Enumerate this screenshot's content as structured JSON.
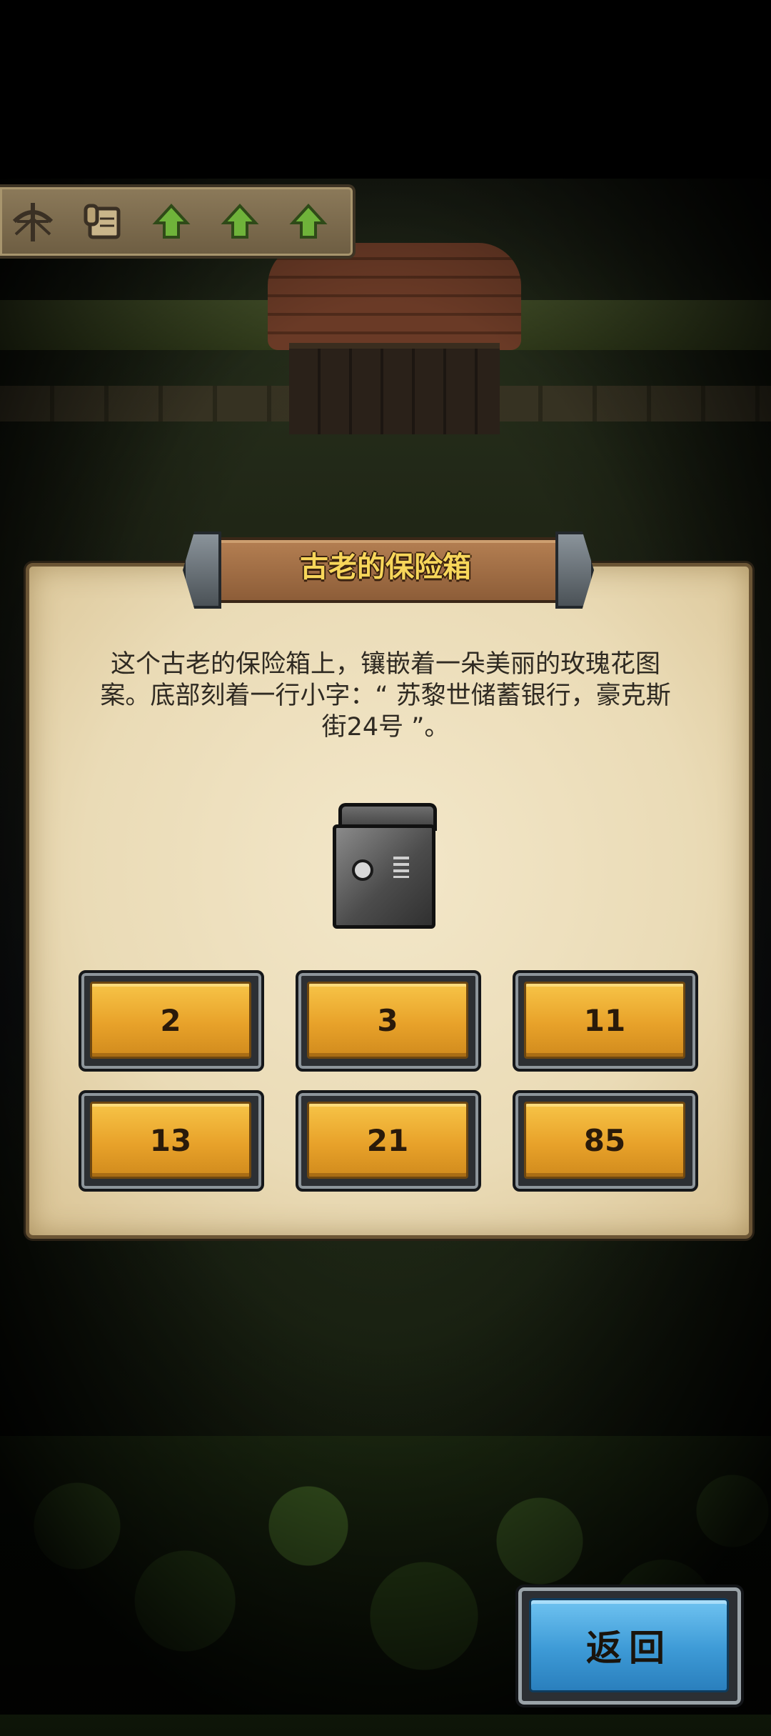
{
  "toolbar": {
    "icons": [
      "crossbow-icon",
      "map-scroll-icon",
      "green-up-arrow-icon",
      "green-up-arrow-icon",
      "green-up-arrow-icon"
    ]
  },
  "dialog": {
    "title": "古老的保险箱",
    "description": "这个古老的保险箱上，镶嵌着一朵美丽的玫瑰花图案。底部刻着一行小字：“ 苏黎世储蓄银行，豪克斯街24号 ”。",
    "item_icon": "safe-icon",
    "options": [
      "2",
      "3",
      "11",
      "13",
      "21",
      "85"
    ]
  },
  "back_button": {
    "label": "返回"
  },
  "colors": {
    "option_gold": "#e8a22a",
    "title_text": "#f7d65a",
    "back_blue": "#3d9ad6",
    "parchment": "#eadbb6"
  }
}
